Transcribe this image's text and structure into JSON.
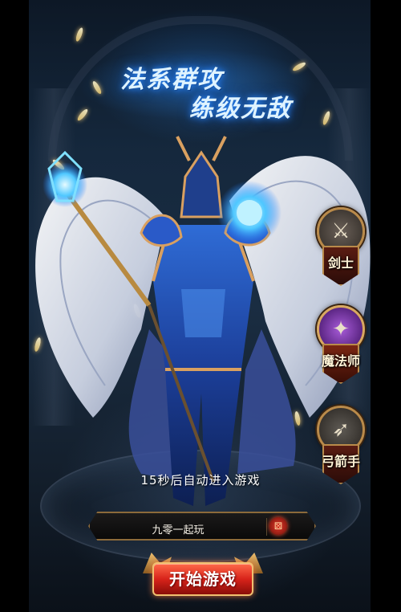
{
  "headline": {
    "line1": "法系群攻",
    "line2": "练级无敌"
  },
  "classes": [
    {
      "id": "swordsman",
      "label": "剑士",
      "icon": "crossed-swords-icon"
    },
    {
      "id": "mage",
      "label": "魔法师",
      "icon": "arcane-sigil-icon"
    },
    {
      "id": "archer",
      "label": "弓箭手",
      "icon": "winged-arrow-icon"
    }
  ],
  "countdown_text": "15秒后自动进入游戏",
  "character_name": "九零一起玩",
  "random_name_icon": "dice-icon",
  "start_button": "开始游戏",
  "colors": {
    "accent_gold": "#b98a4a",
    "start_red": "#d8231a",
    "headline_glow": "#2b8cff"
  }
}
